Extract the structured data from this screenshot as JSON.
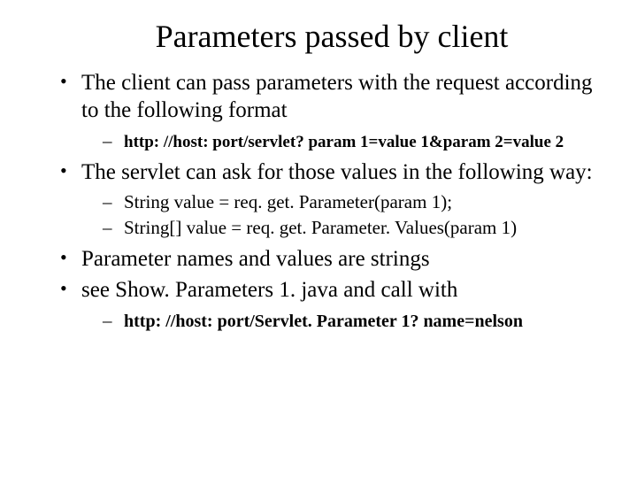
{
  "title": "Parameters passed by client",
  "bullets": {
    "b1": "The client can pass parameters with the request according to the following format",
    "b1_sub1": "http: //host: port/servlet? param 1=value 1&param 2=value 2",
    "b2": "The servlet can ask for those values in the following way:",
    "b2_sub1": "String value = req. get. Parameter(param 1);",
    "b2_sub2": "String[] value = req. get. Parameter. Values(param 1)",
    "b3": "Parameter names and values are strings",
    "b4": "see Show. Parameters 1. java and call with",
    "b4_sub1": "http: //host: port/Servlet. Parameter 1? name=nelson"
  }
}
